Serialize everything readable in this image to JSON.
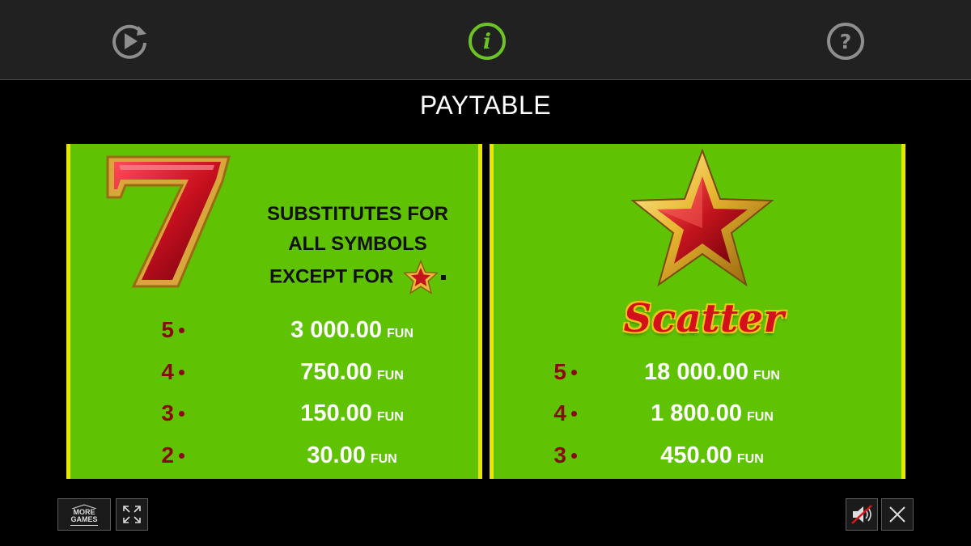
{
  "topbar": {
    "icons": [
      "replay-icon",
      "info-icon",
      "help-icon"
    ],
    "active_color": "#6cc424",
    "inactive_color": "#8e8e8e"
  },
  "title": "PAYTABLE",
  "left_panel": {
    "symbol": "seven-symbol",
    "description": [
      "SUBSTITUTES FOR",
      "ALL SYMBOLS",
      "EXCEPT FOR"
    ],
    "payouts": [
      {
        "count": "5",
        "amount": "3 000.00",
        "currency": "FUN"
      },
      {
        "count": "4",
        "amount": "750.00",
        "currency": "FUN"
      },
      {
        "count": "3",
        "amount": "150.00",
        "currency": "FUN"
      },
      {
        "count": "2",
        "amount": "30.00",
        "currency": "FUN"
      }
    ]
  },
  "right_panel": {
    "symbol": "star-symbol",
    "name": "Scatter",
    "payouts": [
      {
        "count": "5",
        "amount": "18 000.00",
        "currency": "FUN"
      },
      {
        "count": "4",
        "amount": "1 800.00",
        "currency": "FUN"
      },
      {
        "count": "3",
        "amount": "450.00",
        "currency": "FUN"
      }
    ]
  },
  "bottom": {
    "more_games_label": "MORE GAMES"
  },
  "colors": {
    "panel_green": "#5fc304",
    "panel_border": "#e6e600",
    "count_red": "#8a0a0a"
  }
}
